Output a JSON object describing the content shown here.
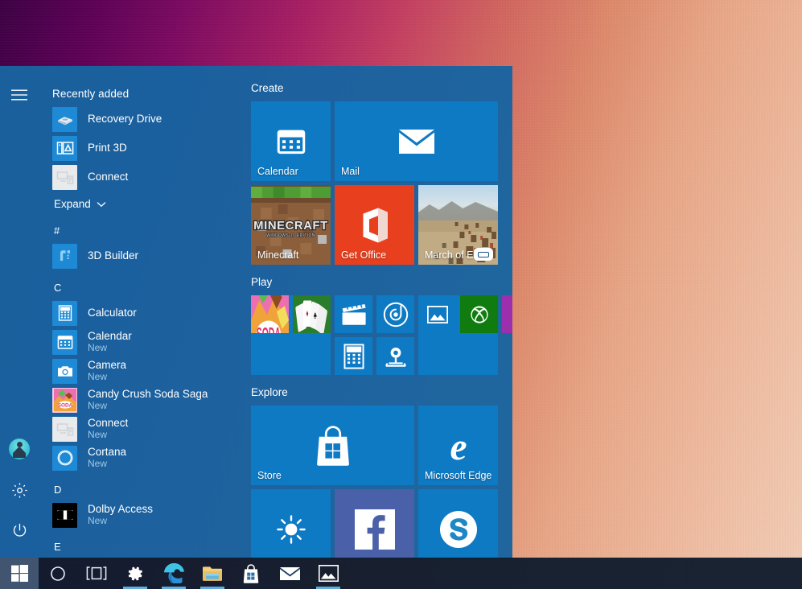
{
  "desktop": {
    "wallpaper_colors": [
      "#3d0043",
      "#a81f63",
      "#d2665f",
      "#f3cdb6"
    ]
  },
  "start_menu": {
    "accent_color": "#0078d7",
    "background_color": "#1764a0",
    "rail": {
      "hamburger_label": "Start menu",
      "hamburger_icon": "hamburger-icon",
      "user_label": "User account",
      "user_icon": "avatar-icon",
      "settings_label": "Settings",
      "settings_icon": "gear-icon",
      "power_label": "Power",
      "power_icon": "power-icon"
    },
    "app_list": {
      "recently_added_header": "Recently added",
      "recently_added": [
        {
          "name": "Recovery Drive",
          "sub": "",
          "icon": "recovery-drive-icon"
        },
        {
          "name": "Print 3D",
          "sub": "",
          "icon": "print-3d-icon"
        },
        {
          "name": "Connect",
          "sub": "",
          "icon": "connect-icon"
        }
      ],
      "expand_label": "Expand",
      "expand_icon": "chevron-down-icon",
      "groups": [
        {
          "letter": "#",
          "apps": [
            {
              "name": "3D Builder",
              "sub": "",
              "icon": "3d-builder-icon"
            }
          ]
        },
        {
          "letter": "C",
          "apps": [
            {
              "name": "Calculator",
              "sub": "",
              "icon": "calculator-icon"
            },
            {
              "name": "Calendar",
              "sub": "New",
              "icon": "calendar-icon"
            },
            {
              "name": "Camera",
              "sub": "New",
              "icon": "camera-icon"
            },
            {
              "name": "Candy Crush Soda Saga",
              "sub": "New",
              "icon": "candy-crush-icon"
            },
            {
              "name": "Connect",
              "sub": "New",
              "icon": "connect-icon"
            },
            {
              "name": "Cortana",
              "sub": "New",
              "icon": "cortana-icon"
            }
          ]
        },
        {
          "letter": "D",
          "apps": [
            {
              "name": "Dolby Access",
              "sub": "New",
              "icon": "dolby-access-icon"
            }
          ]
        },
        {
          "letter": "E",
          "apps": []
        }
      ]
    },
    "tile_groups": [
      {
        "title": "Create",
        "tiles": [
          {
            "name": "Calendar",
            "label": "Calendar",
            "size": "medium",
            "color": "#0e7ac4",
            "icon": "calendar-tile-icon"
          },
          {
            "name": "Mail",
            "label": "Mail",
            "size": "wide",
            "color": "#0e7ac4",
            "icon": "mail-tile-icon"
          },
          {
            "name": "Minecraft",
            "label": "Minecraft",
            "size": "medium",
            "color": "#8c6239",
            "icon": "minecraft-tile-icon"
          },
          {
            "name": "Get Office",
            "label": "Get Office",
            "size": "medium",
            "color": "#e8401f",
            "icon": "office-tile-icon"
          },
          {
            "name": "March of Empires",
            "label": "March of Em",
            "size": "medium",
            "color": "#a08a6d",
            "icon": "march-of-empires-tile-icon"
          }
        ]
      },
      {
        "title": "Play",
        "tiles": [
          {
            "name": "Candy Crush Soda Saga",
            "label": "",
            "size": "small",
            "color": "#f06ba8",
            "icon": "candy-crush-tile-icon"
          },
          {
            "name": "Microsoft Solitaire Collection",
            "label": "",
            "size": "small",
            "color": "#1f7a1f",
            "icon": "solitaire-tile-icon"
          },
          {
            "name": "Movies & TV",
            "label": "",
            "size": "small",
            "color": "#0e7ac4",
            "icon": "movies-tv-tile-icon"
          },
          {
            "name": "Groove Music",
            "label": "",
            "size": "small",
            "color": "#0e7ac4",
            "icon": "groove-music-tile-icon"
          },
          {
            "name": "Calculator",
            "label": "",
            "size": "small",
            "color": "#0e7ac4",
            "icon": "calculator-tile-icon"
          },
          {
            "name": "3D Builder",
            "label": "",
            "size": "small",
            "color": "#0e7ac4",
            "icon": "3d-builder-tile-icon"
          },
          {
            "name": "Photos",
            "label": "",
            "size": "small",
            "color": "#0e7ac4",
            "icon": "photos-tile-icon"
          },
          {
            "name": "Xbox",
            "label": "",
            "size": "small",
            "color": "#107c10",
            "icon": "xbox-tile-icon"
          },
          {
            "name": "OneNote",
            "label": "",
            "size": "small",
            "color": "#9b2fae",
            "icon": "onenote-tile-icon"
          }
        ]
      },
      {
        "title": "Explore",
        "tiles": [
          {
            "name": "Store",
            "label": "Store",
            "size": "wide",
            "color": "#0e7ac4",
            "icon": "store-tile-icon"
          },
          {
            "name": "Microsoft Edge",
            "label": "Microsoft Edge",
            "size": "medium",
            "color": "#0e7ac4",
            "icon": "edge-tile-icon"
          },
          {
            "name": "Weather",
            "label": "",
            "size": "medium",
            "color": "#0e7ac4",
            "icon": "weather-tile-icon"
          },
          {
            "name": "Facebook",
            "label": "",
            "size": "medium",
            "color": "#4a60a8",
            "icon": "facebook-tile-icon"
          },
          {
            "name": "Skype",
            "label": "",
            "size": "medium",
            "color": "#0e7ac4",
            "icon": "skype-tile-icon"
          }
        ]
      }
    ]
  },
  "taskbar": {
    "background_color": "#101c2d",
    "indicator_color": "#63adde",
    "items": [
      {
        "name": "Start",
        "icon": "windows-logo-icon",
        "active": true,
        "running": false
      },
      {
        "name": "Cortana Search",
        "icon": "cortana-circle-icon",
        "active": false,
        "running": false
      },
      {
        "name": "Task View",
        "icon": "task-view-icon",
        "active": false,
        "running": false
      },
      {
        "name": "Settings",
        "icon": "gear-icon",
        "active": false,
        "running": true
      },
      {
        "name": "Microsoft Edge",
        "icon": "edge-icon",
        "active": false,
        "running": true
      },
      {
        "name": "File Explorer",
        "icon": "folder-icon",
        "active": false,
        "running": true
      },
      {
        "name": "Store",
        "icon": "store-icon",
        "active": false,
        "running": false
      },
      {
        "name": "Mail",
        "icon": "mail-icon",
        "active": false,
        "running": false
      },
      {
        "name": "Photos",
        "icon": "photos-icon",
        "active": false,
        "running": true
      }
    ]
  }
}
